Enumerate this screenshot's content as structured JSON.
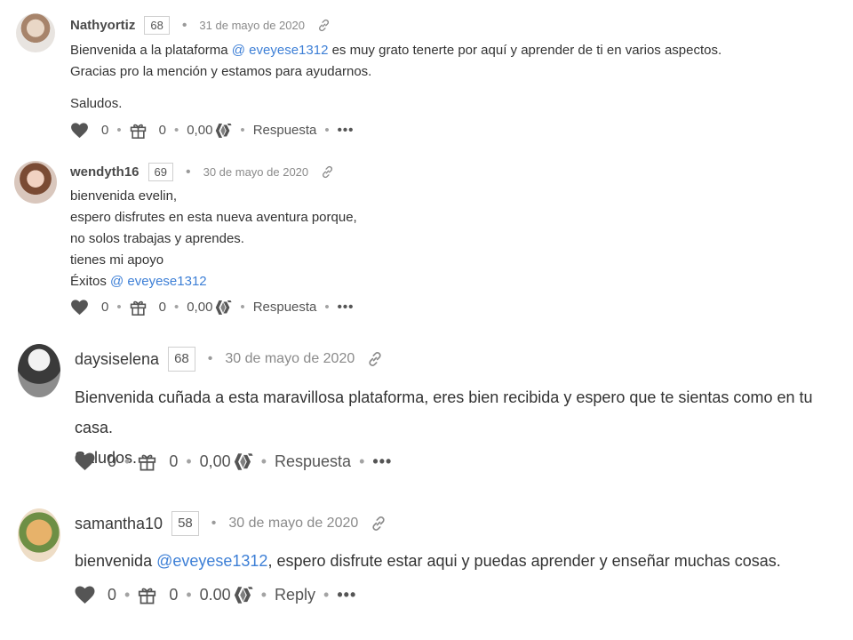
{
  "comments": [
    {
      "username": "Nathyortiz",
      "reputation": "68",
      "date": "31 de mayo de 2020",
      "body": {
        "line1_pre": "Bienvenida a la plataforma ",
        "line1_mention": "@ eveyese1312",
        "line1_post": " es muy grato tenerte por aquí y aprender de ti en varios aspectos.",
        "line2": "Gracias pro la mención y estamos para ayudarnos.",
        "line3": "Saludos."
      },
      "actions": {
        "votes": "0",
        "gifts": "0",
        "payout": "0,00",
        "reply": "Respuesta"
      }
    },
    {
      "username": "wendyth16",
      "reputation": "69",
      "date": "30 de mayo de 2020",
      "body": {
        "line1": "bienvenida evelin,",
        "line2": "espero disfrutes en esta nueva aventura porque,",
        "line3": "no solos trabajas y aprendes.",
        "line4": "tienes mi apoyo",
        "line5_pre": "Éxitos ",
        "line5_mention": "@ eveyese1312"
      },
      "actions": {
        "votes": "0",
        "gifts": "0",
        "payout": "0,00",
        "reply": "Respuesta"
      }
    },
    {
      "username": "daysiselena",
      "reputation": "68",
      "date": "30 de mayo de 2020",
      "body": {
        "line1": "Bienvenida cuñada a esta maravillosa plataforma, eres bien recibida y espero que te sientas como en tu casa.",
        "line2": "Saludos."
      },
      "actions": {
        "votes": "0",
        "gifts": "0",
        "payout": "0,00",
        "reply": "Respuesta"
      }
    },
    {
      "username": "samantha10",
      "reputation": "58",
      "date": "30 de mayo de 2020",
      "body": {
        "line1_pre": "bienvenida ",
        "line1_mention": "@eveyese1312",
        "line1_post": ", espero disfrute estar aqui y puedas aprender y enseñar muchas cosas."
      },
      "actions": {
        "votes": "0",
        "gifts": "0",
        "payout": "0.00",
        "reply": "Reply"
      }
    }
  ],
  "icons": [
    "heart-icon",
    "gift-icon",
    "hive-icon",
    "link-icon",
    "more-icon"
  ],
  "colors": {
    "mention": "#3d7fd6",
    "text": "#333333",
    "muted": "#8a8a8a"
  }
}
